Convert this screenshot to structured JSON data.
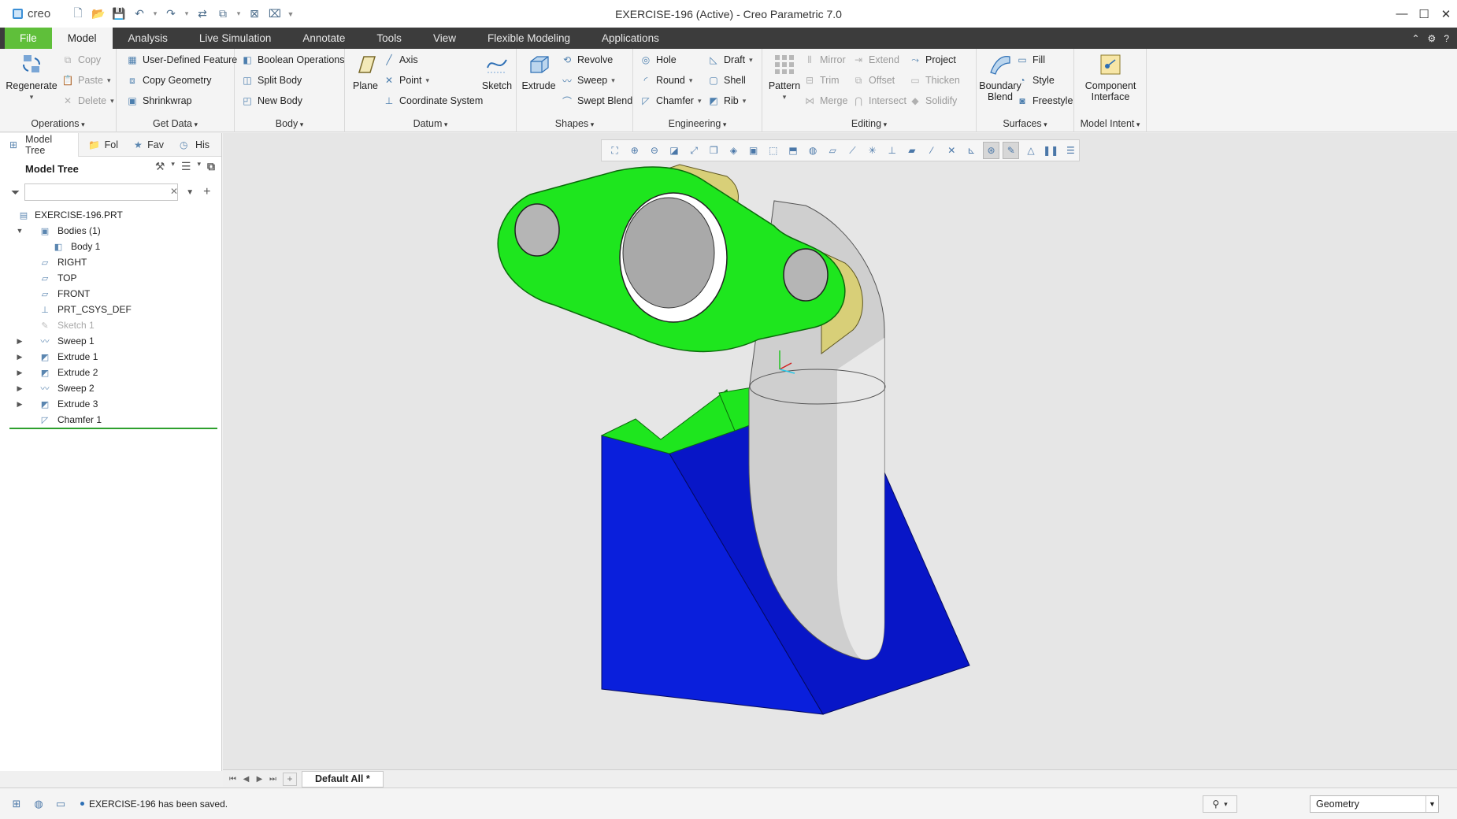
{
  "app": {
    "logo_text": "creo",
    "window_title": "EXERCISE-196 (Active) - Creo Parametric 7.0"
  },
  "window_controls": {
    "minimize": "—",
    "maximize": "☐",
    "close": "✕"
  },
  "quick_access": [
    "new-icon",
    "open-icon",
    "save-icon",
    "undo-icon",
    "redo-icon",
    "regenerate-icon",
    "windows-icon",
    "close-window-icon"
  ],
  "ribbon_tabs": [
    "File",
    "Model",
    "Analysis",
    "Live Simulation",
    "Annotate",
    "Tools",
    "View",
    "Flexible Modeling",
    "Applications"
  ],
  "active_tab": "Model",
  "ribbon": {
    "operations": {
      "label": "Operations",
      "regenerate": "Regenerate",
      "copy": "Copy",
      "paste": "Paste",
      "delete": "Delete"
    },
    "get_data": {
      "label": "Get Data",
      "user_defined_feature": "User-Defined Feature",
      "copy_geometry": "Copy Geometry",
      "shrinkwrap": "Shrinkwrap"
    },
    "body": {
      "label": "Body",
      "boolean_operations": "Boolean Operations",
      "split_body": "Split Body",
      "new_body": "New Body"
    },
    "datum": {
      "label": "Datum",
      "plane": "Plane",
      "axis": "Axis",
      "point": "Point",
      "coordinate_system": "Coordinate System",
      "sketch": "Sketch"
    },
    "shapes": {
      "label": "Shapes",
      "extrude": "Extrude",
      "revolve": "Revolve",
      "sweep": "Sweep",
      "swept_blend": "Swept Blend"
    },
    "engineering": {
      "label": "Engineering",
      "hole": "Hole",
      "round": "Round",
      "chamfer": "Chamfer",
      "draft": "Draft",
      "shell": "Shell",
      "rib": "Rib"
    },
    "editing": {
      "label": "Editing",
      "pattern": "Pattern",
      "mirror": "Mirror",
      "trim": "Trim",
      "merge": "Merge",
      "extend": "Extend",
      "offset": "Offset",
      "intersect": "Intersect",
      "project": "Project",
      "thicken": "Thicken",
      "solidify": "Solidify"
    },
    "surfaces": {
      "label": "Surfaces",
      "boundary_blend_1": "Boundary",
      "boundary_blend_2": "Blend",
      "fill": "Fill",
      "style": "Style",
      "freestyle": "Freestyle"
    },
    "model_intent": {
      "label": "Model Intent",
      "component_interface_1": "Component",
      "component_interface_2": "Interface"
    }
  },
  "nav_tabs": [
    "Model Tree",
    "Fol",
    "Fav",
    "His"
  ],
  "model_tree": {
    "header": "Model Tree",
    "filter_value": "",
    "items": [
      {
        "label": "EXERCISE-196.PRT",
        "icon": "part-icon",
        "level": 0,
        "expander": ""
      },
      {
        "label": "Bodies (1)",
        "icon": "bodies-icon",
        "level": 1,
        "expander": "▼"
      },
      {
        "label": "Body 1",
        "icon": "body-icon",
        "level": 2,
        "expander": ""
      },
      {
        "label": "RIGHT",
        "icon": "datum-plane-icon",
        "level": 1,
        "expander": ""
      },
      {
        "label": "TOP",
        "icon": "datum-plane-icon",
        "level": 1,
        "expander": ""
      },
      {
        "label": "FRONT",
        "icon": "datum-plane-icon",
        "level": 1,
        "expander": ""
      },
      {
        "label": "PRT_CSYS_DEF",
        "icon": "csys-icon",
        "level": 1,
        "expander": ""
      },
      {
        "label": "Sketch 1",
        "icon": "sketch-icon",
        "level": 1,
        "expander": "",
        "disabled": true
      },
      {
        "label": "Sweep 1",
        "icon": "sweep-icon",
        "level": 1,
        "expander": "▶"
      },
      {
        "label": "Extrude 1",
        "icon": "extrude-icon",
        "level": 1,
        "expander": "▶"
      },
      {
        "label": "Extrude 2",
        "icon": "extrude-icon",
        "level": 1,
        "expander": "▶"
      },
      {
        "label": "Sweep 2",
        "icon": "sweep-icon",
        "level": 1,
        "expander": "▶"
      },
      {
        "label": "Extrude 3",
        "icon": "extrude-icon",
        "level": 1,
        "expander": "▶"
      },
      {
        "label": "Chamfer 1",
        "icon": "chamfer-icon",
        "level": 1,
        "expander": ""
      }
    ]
  },
  "view_tabs": {
    "active": "Default All *"
  },
  "status": {
    "message": "EXERCISE-196 has been saved.",
    "selection_filter": "Geometry"
  },
  "colors": {
    "file_tab": "#5fbf3a",
    "tab_bar": "#3c3c3c",
    "flange_green": "#1ee61e",
    "flange_edge": "#d8cf78",
    "base_blue": "#0a1fdc",
    "pipe_gray": "#c8c8c8",
    "tree_insert_line": "#2ea02e"
  }
}
